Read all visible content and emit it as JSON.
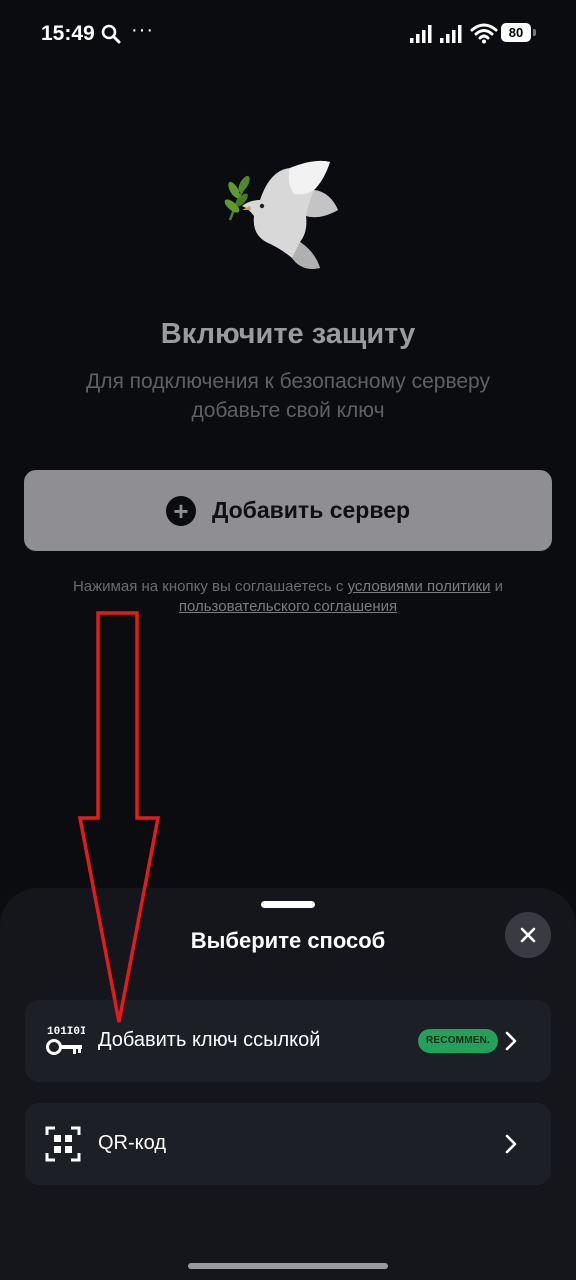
{
  "status_bar": {
    "time": "15:49",
    "dots": "···",
    "battery": "80"
  },
  "main": {
    "title": "Включите защиту",
    "subtitle": "Для подключения к безопасному серверу добавьте свой ключ",
    "add_server_label": "Добавить сервер",
    "add_server_icon": "plus-circle-icon",
    "terms_text": "Нажимая на кнопку вы соглашаетесь с",
    "terms_link1": "условиями политики",
    "terms_and": "и",
    "terms_link2": "пользовательского соглашения"
  },
  "sheet": {
    "title": "Выберите способ",
    "options": [
      {
        "label": "Добавить ключ ссылкой",
        "badge": "RECOMMEN.",
        "icon": "key-link-icon"
      },
      {
        "label": "QR-код",
        "icon": "qr-code-icon"
      }
    ]
  },
  "colors": {
    "background": "#0b0c10",
    "sheet": "#14161c",
    "option_bg": "#1d1f27",
    "button_bg": "#8e8e93",
    "badge_green": "#23a15a",
    "annotation_red": "#e21b1b"
  }
}
